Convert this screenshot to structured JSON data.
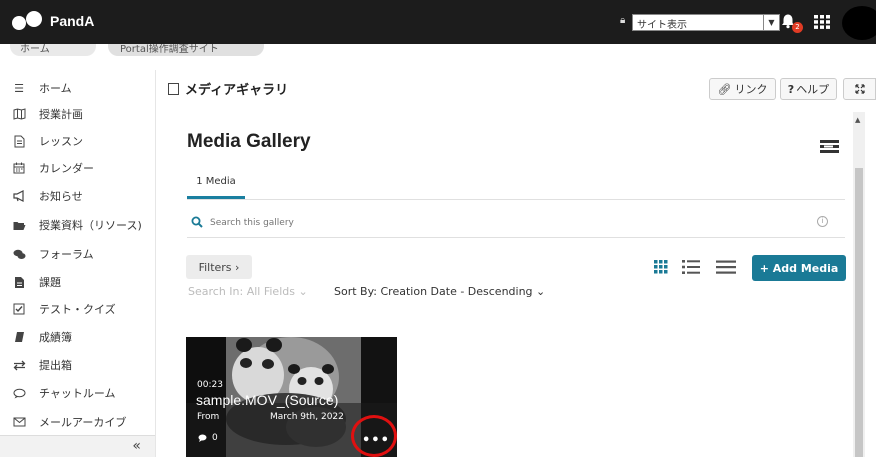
{
  "header": {
    "brand": "PandA",
    "site_select": "サイト表示",
    "notification_count": "2"
  },
  "breadcrumb": {
    "items": [
      "ホーム",
      "Portal操作調査サイト"
    ]
  },
  "sidebar": {
    "items": [
      {
        "label": "ホーム",
        "icon": "list-icon"
      },
      {
        "label": "授業計画",
        "icon": "map-icon"
      },
      {
        "label": "レッスン",
        "icon": "document-icon"
      },
      {
        "label": "カレンダー",
        "icon": "calendar-icon"
      },
      {
        "label": "お知らせ",
        "icon": "megaphone-icon"
      },
      {
        "label": "授業資料（リソース)",
        "icon": "folder-icon"
      },
      {
        "label": "フォーラム",
        "icon": "chat-bubbles-icon"
      },
      {
        "label": "課題",
        "icon": "assignment-icon"
      },
      {
        "label": "テスト・クイズ",
        "icon": "checkbox-icon"
      },
      {
        "label": "成績簿",
        "icon": "book-icon"
      },
      {
        "label": "提出箱",
        "icon": "exchange-icon"
      },
      {
        "label": "チャットルーム",
        "icon": "chat-icon"
      },
      {
        "label": "メールアーカイブ",
        "icon": "mail-icon"
      }
    ],
    "collapse_label": "«"
  },
  "tool": {
    "title": "メディアギャラリ",
    "link_label": "リンク",
    "help_label": "ヘルプ"
  },
  "gallery": {
    "title": "Media Gallery",
    "tab_label": "1 Media",
    "search_placeholder": "Search this gallery",
    "filters_label": "Filters ›",
    "search_in_label": "Search In: All Fields ⌄",
    "sort_label": "Sort By: Creation Date - Descending ⌄",
    "add_media_label": "+ Add Media"
  },
  "media": [
    {
      "duration": "00:23",
      "name": "sample.MOV_(Source)",
      "from": "From",
      "date": "March 9th, 2022",
      "comments": "0",
      "more": "•••"
    }
  ],
  "colors": {
    "topbar": "#1c1c1c",
    "accent": "#1a7a96",
    "highlight": "#e01010",
    "badge": "#e03b24"
  }
}
